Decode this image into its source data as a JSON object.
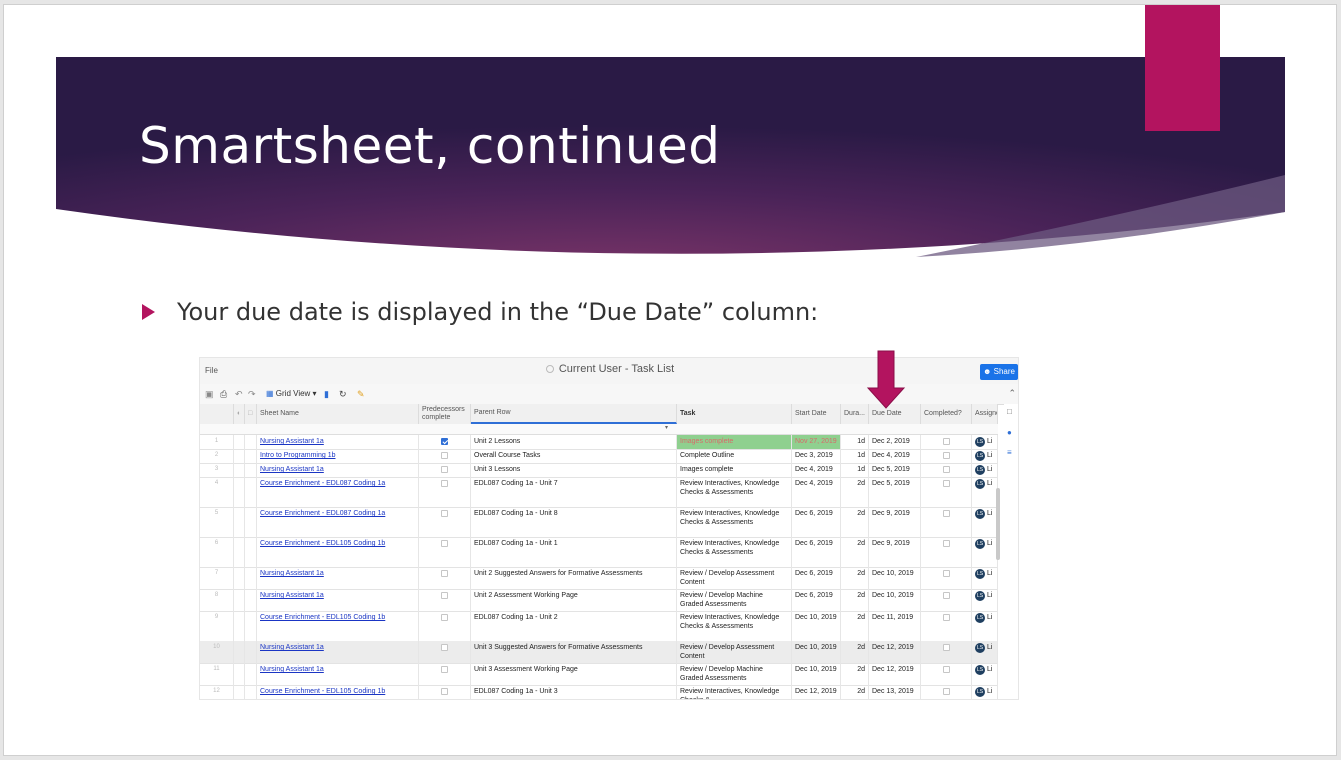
{
  "slide": {
    "title": "Smartsheet, continued",
    "bullet": "Your due date is displayed in the “Due Date” column:",
    "colors": {
      "banner_dark": "#2a1a45",
      "banner_mid": "#6b2d63",
      "accent": "#b3145f",
      "bullet": "#b3145f"
    }
  },
  "app": {
    "menu_file": "File",
    "doc_title": "Current User - Task List",
    "share_label": "Share",
    "toolbar": {
      "grid_view": "Grid View ▾"
    },
    "columns": [
      "Sheet Name",
      "Predecessors complete",
      "Parent Row",
      "Task",
      "Start Date",
      "Dura...",
      "Due Date",
      "Completed?",
      "Assigned"
    ],
    "rows": [
      {
        "n": "1",
        "sheet": "Nursing Assistant 1a",
        "pred": true,
        "parent": "Unit 2 Lessons",
        "task": "Images complete",
        "start": "Nov 27, 2019",
        "dur": "1d",
        "due": "Dec 2, 2019",
        "assignee": "Li"
      },
      {
        "n": "2",
        "sheet": "Intro to Programming 1b",
        "pred": false,
        "parent": "Overall Course Tasks",
        "task": "Complete Outline",
        "start": "Dec 3, 2019",
        "dur": "1d",
        "due": "Dec 4, 2019",
        "assignee": "Li"
      },
      {
        "n": "3",
        "sheet": "Nursing Assistant 1a",
        "pred": false,
        "parent": "Unit 3 Lessons",
        "task": "Images complete",
        "start": "Dec 4, 2019",
        "dur": "1d",
        "due": "Dec 5, 2019",
        "assignee": "Li"
      },
      {
        "n": "4",
        "sheet": "Course Enrichment - EDL087 Coding 1a",
        "pred": false,
        "parent": "EDL087 Coding 1a - Unit 7",
        "task": "Review Interactives, Knowledge Checks & Assessments",
        "start": "Dec 4, 2019",
        "dur": "2d",
        "due": "Dec 5, 2019",
        "assignee": "Li"
      },
      {
        "n": "5",
        "sheet": "Course Enrichment - EDL087 Coding 1a",
        "pred": false,
        "parent": "EDL087 Coding 1a - Unit 8",
        "task": "Review Interactives, Knowledge Checks & Assessments",
        "start": "Dec 6, 2019",
        "dur": "2d",
        "due": "Dec 9, 2019",
        "assignee": "Li"
      },
      {
        "n": "6",
        "sheet": "Course Enrichment - EDL105 Coding 1b",
        "pred": false,
        "parent": "EDL087 Coding 1a - Unit 1",
        "task": "Review Interactives, Knowledge Checks & Assessments",
        "start": "Dec 6, 2019",
        "dur": "2d",
        "due": "Dec 9, 2019",
        "assignee": "Li"
      },
      {
        "n": "7",
        "sheet": "Nursing Assistant 1a",
        "pred": false,
        "parent": "Unit 2 Suggested Answers for Formative Assessments",
        "task": "Review / Develop Assessment Content",
        "start": "Dec 6, 2019",
        "dur": "2d",
        "due": "Dec 10, 2019",
        "assignee": "Li"
      },
      {
        "n": "8",
        "sheet": "Nursing Assistant 1a",
        "pred": false,
        "parent": "Unit 2 Assessment Working Page",
        "task": "Review / Develop Machine Graded Assessments",
        "start": "Dec 6, 2019",
        "dur": "2d",
        "due": "Dec 10, 2019",
        "assignee": "Li"
      },
      {
        "n": "9",
        "sheet": "Course Enrichment - EDL105 Coding 1b",
        "pred": false,
        "parent": "EDL087 Coding 1a - Unit 2",
        "task": "Review Interactives, Knowledge Checks & Assessments",
        "start": "Dec 10, 2019",
        "dur": "2d",
        "due": "Dec 11, 2019",
        "assignee": "Li"
      },
      {
        "n": "10",
        "sheet": "Nursing Assistant 1a",
        "pred": false,
        "parent": "Unit 3 Suggested Answers for Formative Assessments",
        "task": "Review / Develop Assessment Content",
        "start": "Dec 10, 2019",
        "dur": "2d",
        "due": "Dec 12, 2019",
        "assignee": "Li"
      },
      {
        "n": "11",
        "sheet": "Nursing Assistant 1a",
        "pred": false,
        "parent": "Unit 3 Assessment Working Page",
        "task": "Review / Develop Machine Graded Assessments",
        "start": "Dec 10, 2019",
        "dur": "2d",
        "due": "Dec 12, 2019",
        "assignee": "Li"
      },
      {
        "n": "12",
        "sheet": "Course Enrichment - EDL105 Coding 1b",
        "pred": false,
        "parent": "EDL087 Coding 1a - Unit 3",
        "task": "Review Interactives, Knowledge Checks &",
        "start": "Dec 12, 2019",
        "dur": "2d",
        "due": "Dec 13, 2019",
        "assignee": "Li"
      }
    ],
    "avatar_initials": "LS",
    "icons": [
      "save-icon",
      "print-icon",
      "undo-icon",
      "redo-icon",
      "grid-view-icon",
      "refresh-icon",
      "highlight-icon",
      "share-people-icon",
      "comment-icon",
      "globe-icon",
      "settings-icon"
    ]
  }
}
